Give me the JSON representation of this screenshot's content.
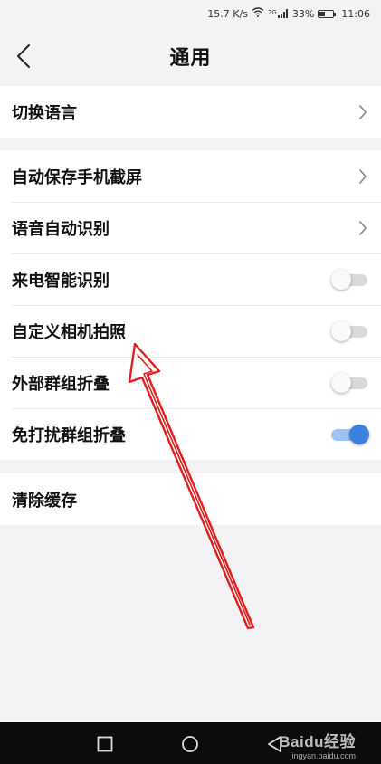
{
  "status_bar": {
    "net_speed": "15.7 K/s",
    "network_type": "2G",
    "battery_percent": "33%",
    "time": "11:06"
  },
  "header": {
    "title": "通用"
  },
  "section1": {
    "items": [
      {
        "label": "切换语言"
      }
    ]
  },
  "section2": {
    "items": [
      {
        "label": "自动保存手机截屏",
        "control": "chevron"
      },
      {
        "label": "语音自动识别",
        "control": "chevron"
      },
      {
        "label": "来电智能识别",
        "control": "toggle",
        "on": false
      },
      {
        "label": "自定义相机拍照",
        "control": "toggle",
        "on": false
      },
      {
        "label": "外部群组折叠",
        "control": "toggle",
        "on": false
      },
      {
        "label": "免打扰群组折叠",
        "control": "toggle",
        "on": true
      }
    ]
  },
  "section3": {
    "items": [
      {
        "label": "清除缓存"
      }
    ]
  },
  "watermark": {
    "brand": "Baidu经验",
    "url": "jingyan.baidu.com"
  },
  "colors": {
    "accent": "#3b82e0",
    "annotation": "#e0201f",
    "background": "#f3f3f5"
  }
}
